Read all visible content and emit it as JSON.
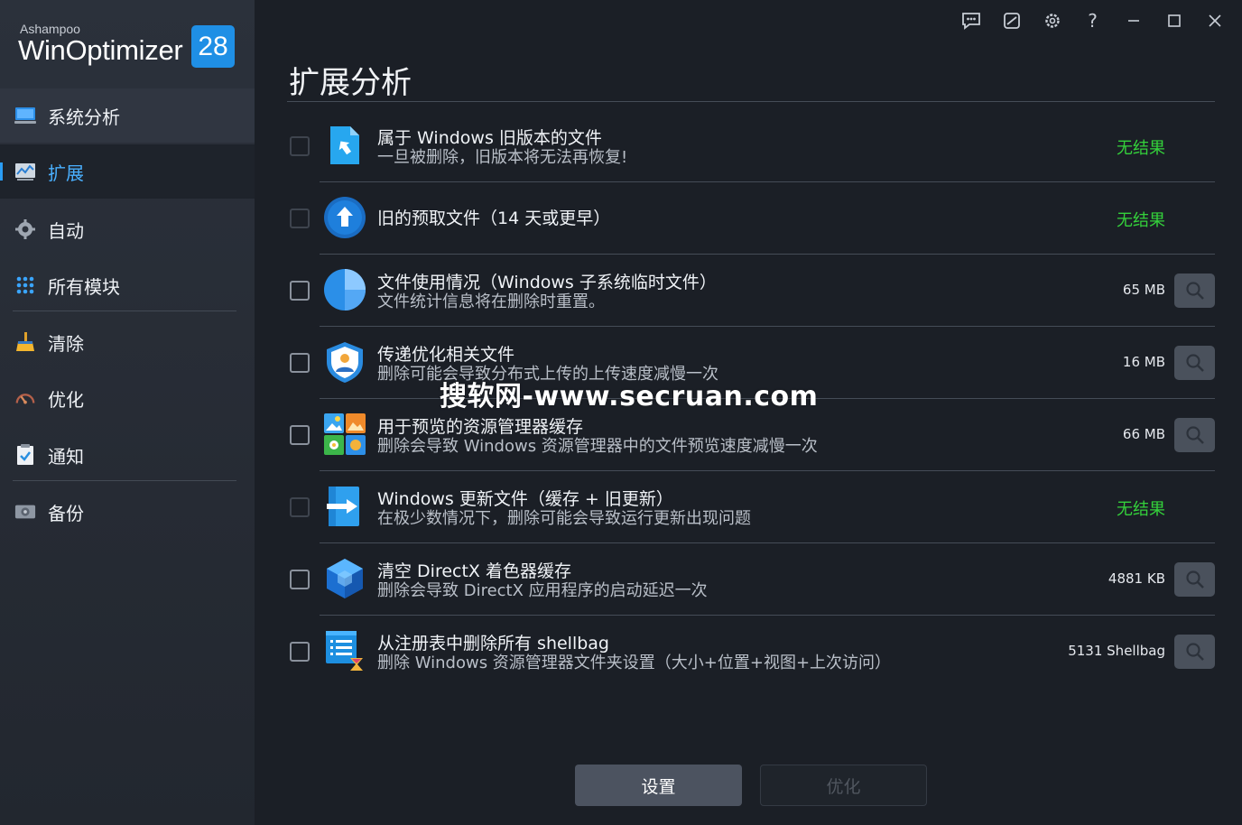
{
  "app": {
    "brand_small": "Ashampoo",
    "brand_main": "WinOptimizer",
    "version_badge": "28"
  },
  "topbar": {
    "icons": [
      "feedback-icon",
      "skin-icon",
      "settings-icon",
      "help-icon",
      "minimize-icon",
      "maximize-icon",
      "close-icon"
    ],
    "help_label": "?"
  },
  "sidebar": {
    "items": [
      {
        "label": "系统分析",
        "icon": "monitor-icon"
      },
      {
        "label": "扩展",
        "icon": "chart-icon",
        "active": true
      },
      {
        "label": "自动",
        "icon": "gear-auto-icon"
      },
      {
        "label": "所有模块",
        "icon": "grid-icon"
      },
      {
        "label": "清除",
        "icon": "broom-icon"
      },
      {
        "label": "优化",
        "icon": "speedometer-icon"
      },
      {
        "label": "通知",
        "icon": "checklist-icon"
      },
      {
        "label": "备份",
        "icon": "backup-icon"
      }
    ]
  },
  "main": {
    "title": "扩展分析",
    "rows": [
      {
        "title": "属于 Windows 旧版本的文件",
        "subtitle": "一旦被删除，旧版本将无法再恢复!",
        "status": "无结果",
        "icon": "old-windows-file-icon",
        "checkbox_enabled": false
      },
      {
        "title": "旧的预取文件（14 天或更早）",
        "subtitle": "",
        "status": "无结果",
        "icon": "prefetch-upload-icon",
        "checkbox_enabled": false
      },
      {
        "title": "文件使用情况（Windows 子系统临时文件）",
        "subtitle": "文件统计信息将在删除时重置。",
        "size": "65 MB",
        "icon": "pie-chart-icon",
        "checkbox_enabled": true
      },
      {
        "title": "传递优化相关文件",
        "subtitle": "删除可能会导致分布式上传的上传速度减慢一次",
        "size": "16 MB",
        "icon": "shield-user-icon",
        "checkbox_enabled": true
      },
      {
        "title": "用于预览的资源管理器缓存",
        "subtitle": "删除会导致 Windows 资源管理器中的文件预览速度减慢一次",
        "size": "66 MB",
        "icon": "image-tiles-icon",
        "checkbox_enabled": true
      },
      {
        "title": "Windows 更新文件（缓存 + 旧更新）",
        "subtitle": "在极少数情况下，删除可能会导致运行更新出现问题",
        "status": "无结果",
        "icon": "windows-update-icon",
        "checkbox_enabled": false
      },
      {
        "title": "清空 DirectX 着色器缓存",
        "subtitle": "删除会导致 DirectX 应用程序的启动延迟一次",
        "size": "4881 KB",
        "icon": "directx-cube-icon",
        "checkbox_enabled": true
      },
      {
        "title": "从注册表中删除所有 shellbag",
        "subtitle": "删除 Windows 资源管理器文件夹设置（大小+位置+视图+上次访问）",
        "size": "5131 Shellbag",
        "icon": "registry-list-icon",
        "checkbox_enabled": true
      }
    ],
    "watermark": "搜软网-www.secruan.com",
    "settings_button": "设置",
    "optimize_button": "优化"
  },
  "colors": {
    "accent": "#2a9df4",
    "success": "#34d13b",
    "background": "#1b1f26",
    "sidebar": "#2b313b"
  }
}
